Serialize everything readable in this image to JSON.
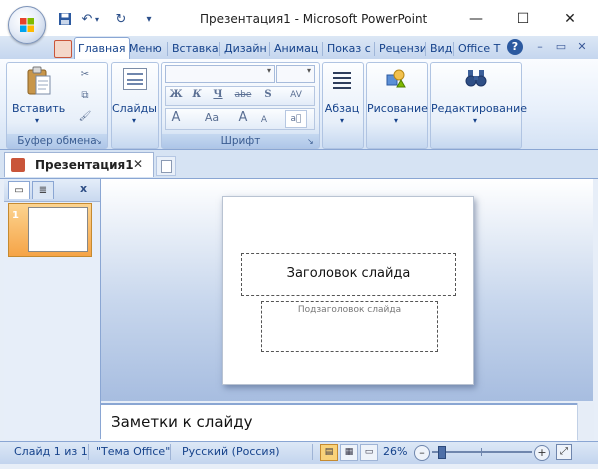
{
  "window": {
    "title": "Презентация1 - Microsoft PowerPoint",
    "minimize": "—",
    "maximize": "☐",
    "close": "✕"
  },
  "qat": {
    "save": "💾",
    "undo": "↶",
    "redo": "↻",
    "more": "▾"
  },
  "tabs": [
    "Главная",
    "Меню",
    "Вставка",
    "Дизайн",
    "Анимац",
    "Показ с",
    "Рецензи",
    "Вид",
    "Office T"
  ],
  "ribbon_tools": {
    "help": "?",
    "restore": "▭",
    "close": "✕",
    "min": "–"
  },
  "ribbon": {
    "clipboard": {
      "paste": "Вставить",
      "label": "Буфер обмена"
    },
    "slides": {
      "button": "Слайды"
    },
    "font": {
      "label": "Шрифт",
      "bold": "Ж",
      "italic": "К",
      "underline": "Ч",
      "strike": "abe",
      "shadow": "S",
      "spacing": "AV",
      "grow": "A",
      "case": "Aa",
      "shrink": "A",
      "clear": "A"
    },
    "paragraph": {
      "button": "Абзац"
    },
    "drawing": {
      "button": "Рисование"
    },
    "editing": {
      "button": "Редактирование"
    }
  },
  "doc": {
    "tab_name": "Презентация1",
    "tab_close": "✕"
  },
  "left_panel": {
    "tab_close": "x",
    "slide_number": "1"
  },
  "slide": {
    "title_placeholder": "Заголовок слайда",
    "subtitle_placeholder": "Подзаголовок слайда"
  },
  "notes": {
    "placeholder": "Заметки к слайду"
  },
  "status": {
    "slide_info": "Слайд 1 из 1",
    "theme": "\"Тема Office\"",
    "language": "Русский (Россия)",
    "zoom": "26%",
    "zoom_out": "–",
    "zoom_in": "+"
  },
  "colors": {
    "accent": "#15428b",
    "ribbon_border": "#8aa6d3",
    "thumb_selected": "#f6a447"
  }
}
